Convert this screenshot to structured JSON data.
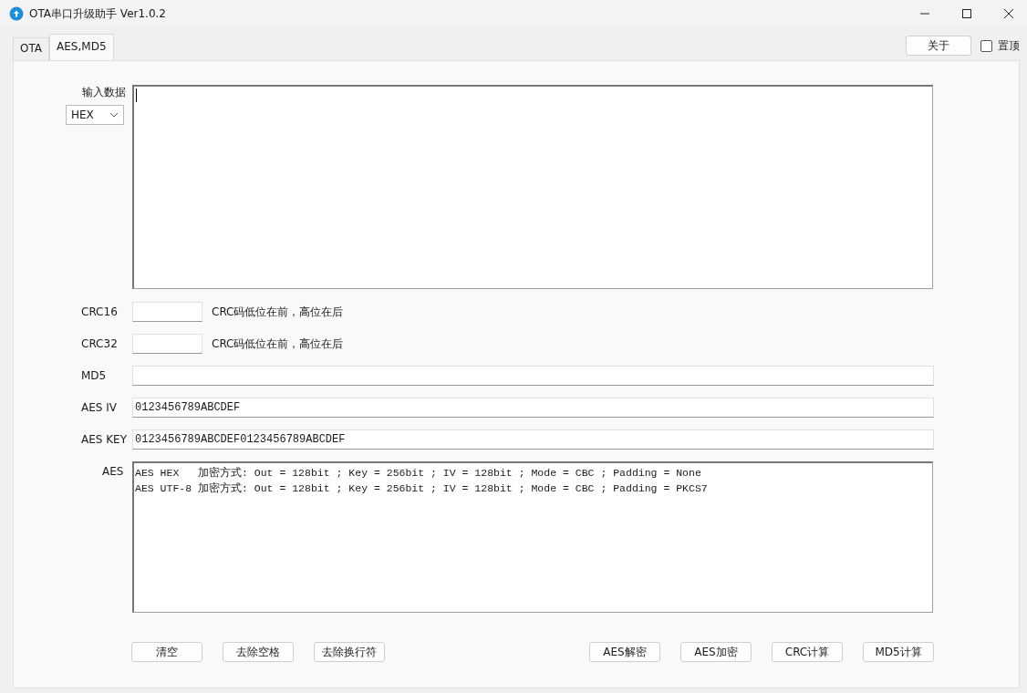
{
  "window": {
    "title": "OTA串口升级助手 Ver1.0.2"
  },
  "tabs": [
    {
      "label": "OTA",
      "selected": false
    },
    {
      "label": "AES,MD5",
      "selected": true
    }
  ],
  "about_button": "关于",
  "pin_top": {
    "label": "置顶",
    "checked": false
  },
  "input": {
    "label": "输入数据",
    "format": "HEX"
  },
  "fields": [
    {
      "kind": "short",
      "label": "CRC16",
      "note": "CRC码低位在前，高位在后"
    },
    {
      "kind": "short",
      "label": "CRC32",
      "note": "CRC码低位在前，高位在后"
    },
    {
      "kind": "wide",
      "label": "MD5"
    },
    {
      "kind": "wide",
      "label": "AES IV",
      "value": "0123456789ABCDEF"
    },
    {
      "kind": "wide",
      "label": "AES KEY",
      "value": "0123456789ABCDEF0123456789ABCDEF"
    }
  ],
  "aes_output": {
    "label": "AES",
    "lines": [
      "AES HEX   加密方式: Out = 128bit ; Key = 256bit ; IV = 128bit ; Mode = CBC ; Padding = None",
      "AES UTF-8 加密方式: Out = 128bit ; Key = 256bit ; IV = 128bit ; Mode = CBC ; Padding = PKCS7"
    ]
  },
  "left_buttons": [
    "清空",
    "去除空格",
    "去除换行符"
  ],
  "right_buttons": [
    "AES解密",
    "AES加密",
    "CRC计算",
    "MD5计算"
  ]
}
